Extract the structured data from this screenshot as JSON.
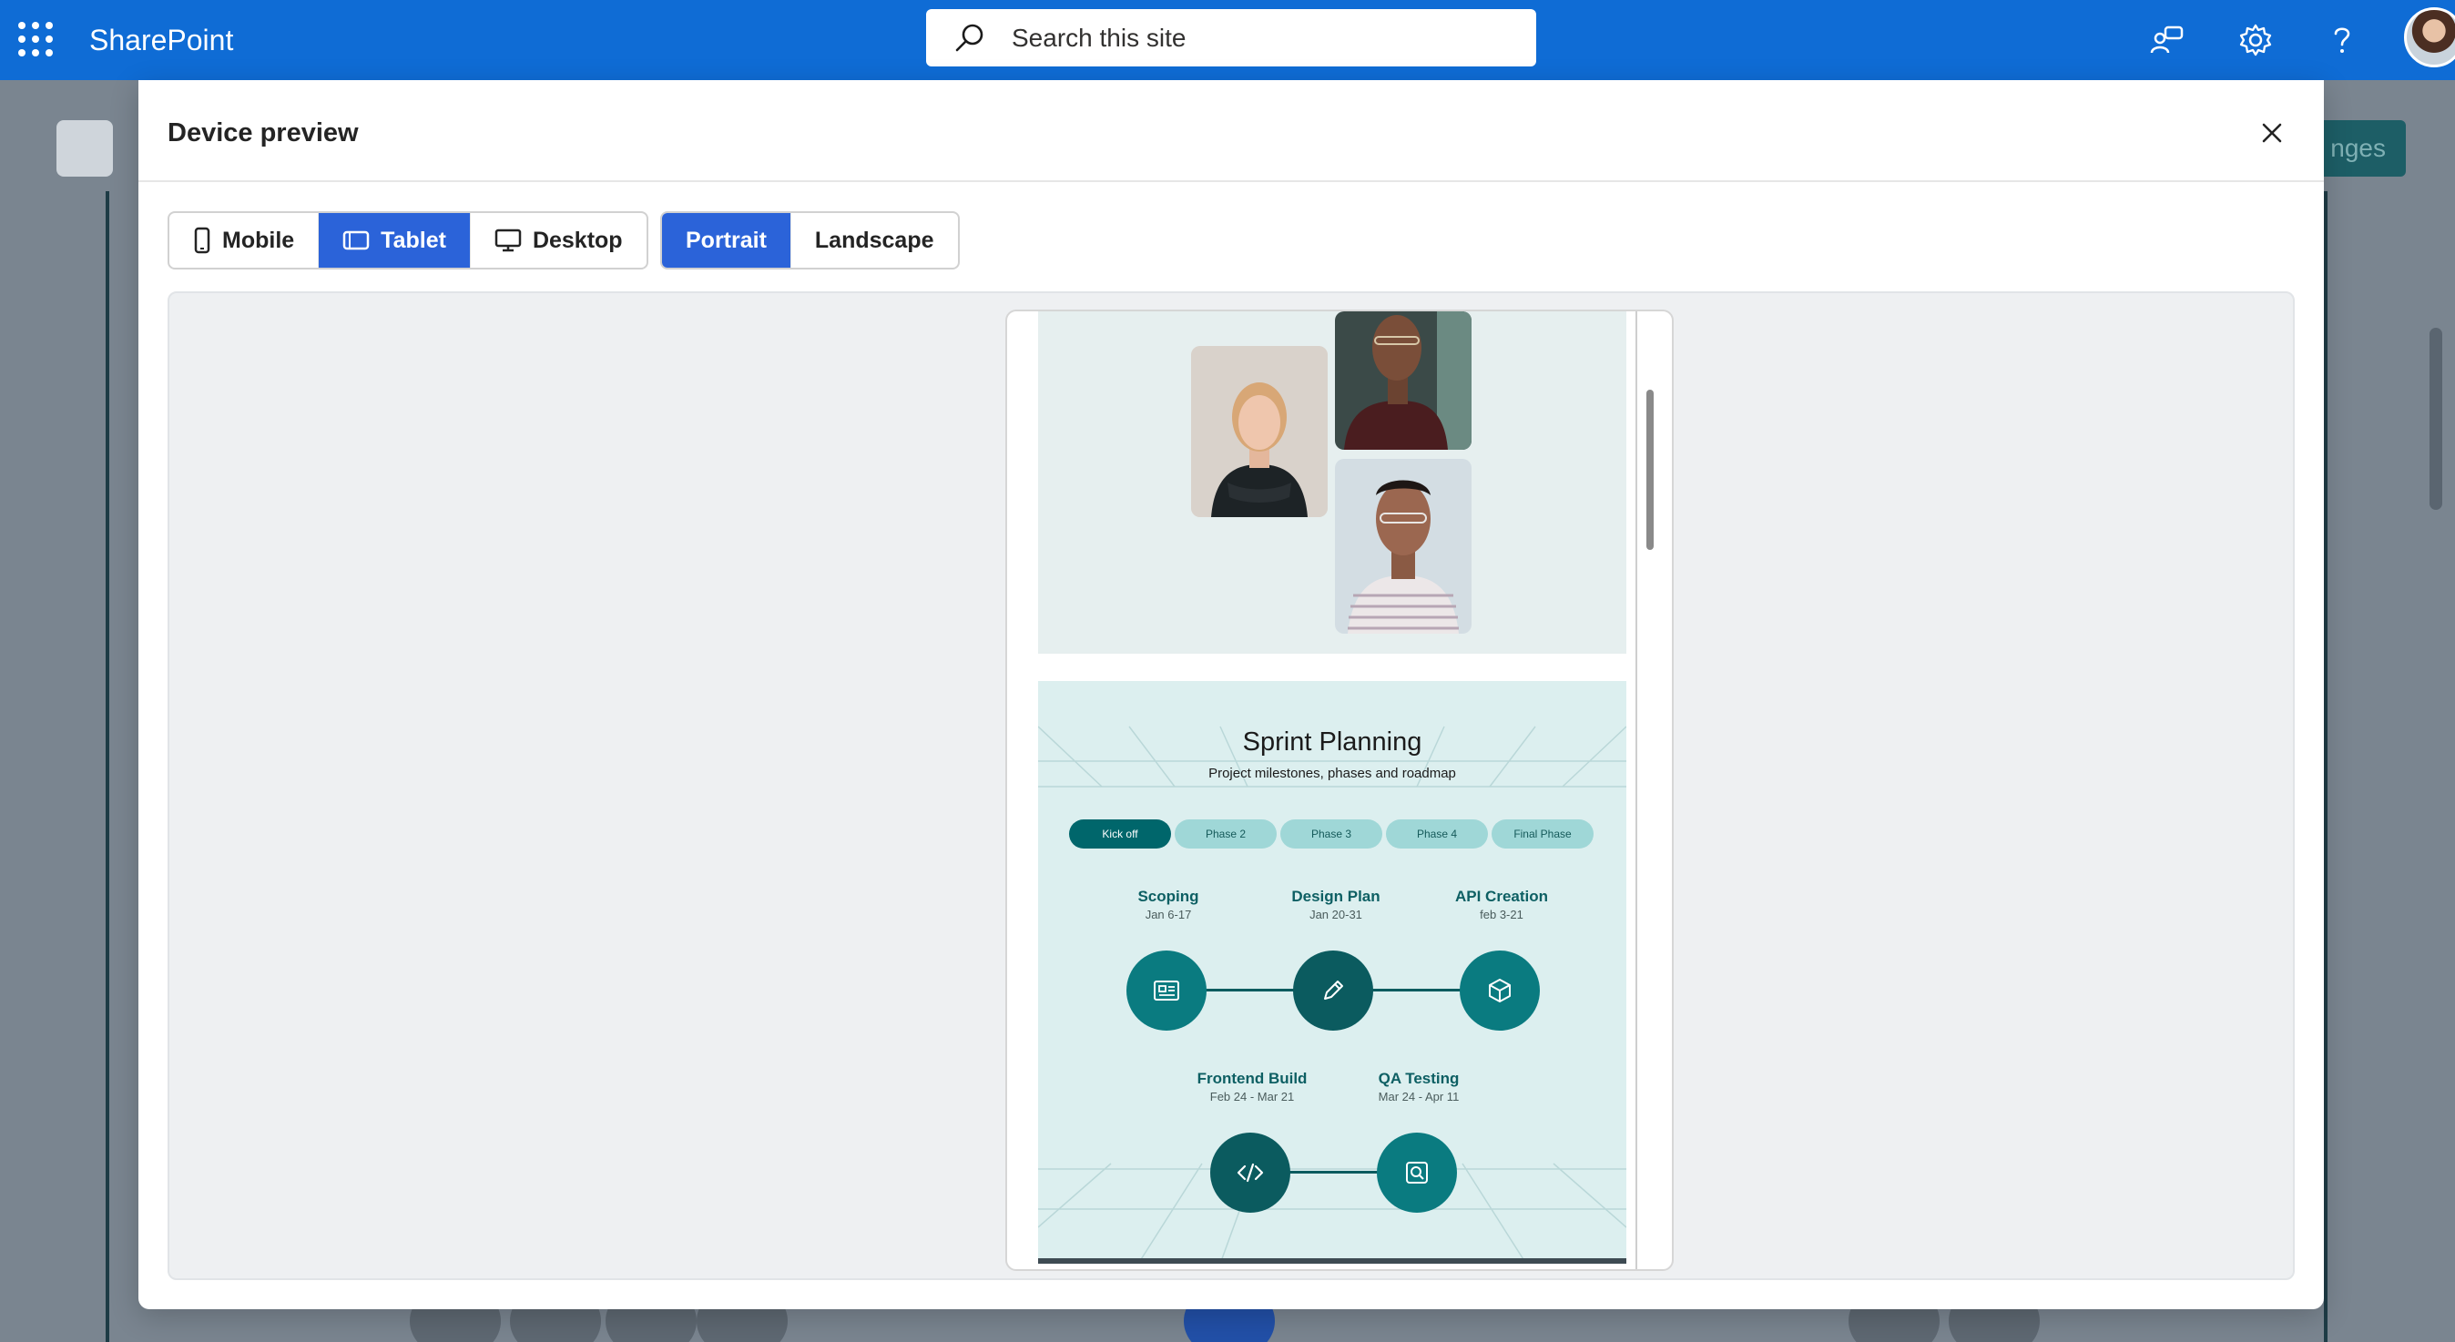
{
  "suite_bar": {
    "app_name": "SharePoint",
    "search_placeholder": "Search this site",
    "accent_color": "#0f6cd5"
  },
  "background_page": {
    "save_button_label_fragment": "nges"
  },
  "modal": {
    "title": "Device preview",
    "device_options": [
      {
        "label": "Mobile",
        "icon": "mobile-icon",
        "selected": false
      },
      {
        "label": "Tablet",
        "icon": "tablet-icon",
        "selected": true
      },
      {
        "label": "Desktop",
        "icon": "desktop-icon",
        "selected": false
      }
    ],
    "orientation_options": [
      {
        "label": "Portrait",
        "selected": true
      },
      {
        "label": "Landscape",
        "selected": false
      }
    ],
    "selected_color": "#2b63d9"
  },
  "preview": {
    "sprint": {
      "title": "Sprint Planning",
      "subtitle": "Project milestones, phases and roadmap",
      "phases": [
        "Kick off",
        "Phase 2",
        "Phase 3",
        "Phase 4",
        "Final Phase"
      ],
      "active_phase": "Kick off",
      "milestones": [
        {
          "name": "Scoping",
          "dates": "Jan 6-17",
          "icon": "newspaper-icon"
        },
        {
          "name": "Design Plan",
          "dates": "Jan 20-31",
          "icon": "pencil-icon"
        },
        {
          "name": "API Creation",
          "dates": "feb 3-21",
          "icon": "cube-icon"
        },
        {
          "name": "Frontend Build",
          "dates": "Feb 24 - Mar 21",
          "icon": "code-icon"
        },
        {
          "name": "QA Testing",
          "dates": "Mar 24 - Apr 11",
          "icon": "search-document-icon"
        }
      ],
      "teal_color": "#0a7b80"
    }
  }
}
